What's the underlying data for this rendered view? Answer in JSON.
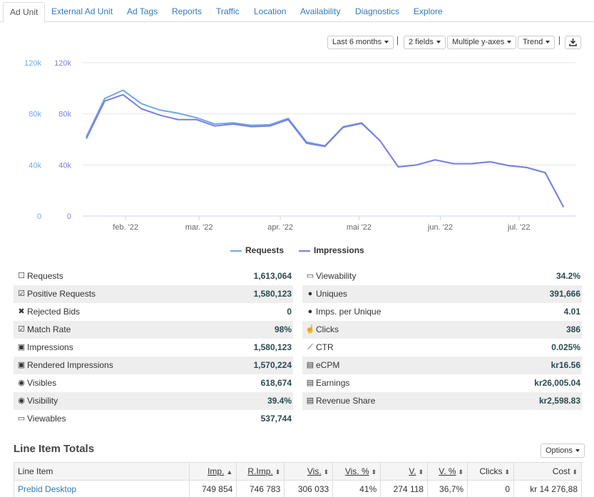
{
  "tabs": [
    "Ad Unit",
    "External Ad Unit",
    "Ad Tags",
    "Reports",
    "Traffic",
    "Location",
    "Availability",
    "Diagnostics",
    "Explore"
  ],
  "active_tab": "Ad Unit",
  "toolbar": {
    "range": "Last 6 months",
    "fields": "2 fields",
    "axes": "Multiple y-axes",
    "trend": "Trend",
    "download_icon": "download-icon"
  },
  "chart_data": {
    "type": "line",
    "x": [
      "2022-01-17",
      "2022-01-24",
      "2022-01-31",
      "2022-02-07",
      "2022-02-14",
      "2022-02-21",
      "2022-02-28",
      "2022-03-07",
      "2022-03-14",
      "2022-03-21",
      "2022-03-28",
      "2022-04-04",
      "2022-04-11",
      "2022-04-18",
      "2022-04-25",
      "2022-05-02",
      "2022-05-09",
      "2022-05-16",
      "2022-05-23",
      "2022-05-30",
      "2022-06-06",
      "2022-06-13",
      "2022-06-20",
      "2022-06-27",
      "2022-07-04",
      "2022-07-11",
      "2022-07-18"
    ],
    "x_tick_labels": [
      "feb. '22",
      "mar. '22",
      "apr. '22",
      "mai '22",
      "jun. '22",
      "jul. '22"
    ],
    "y_tick_labels": [
      "0",
      "40k",
      "80k",
      "120k"
    ],
    "ylim": [
      0,
      120000
    ],
    "grid": true,
    "legend_position": "bottom",
    "series": [
      {
        "name": "Requests",
        "color": "#6fa8e6",
        "values": [
          62000,
          92000,
          98500,
          88000,
          83000,
          80500,
          77000,
          72000,
          73000,
          71000,
          71500,
          76500,
          58000,
          55000,
          70000,
          73000,
          59000,
          38500,
          40000,
          44000,
          41000,
          41000,
          42500,
          39500,
          38000,
          34000,
          7000
        ]
      },
      {
        "name": "Impressions",
        "color": "#7b7fe0",
        "values": [
          60500,
          90000,
          95000,
          84000,
          79000,
          75500,
          75500,
          70500,
          72000,
          70000,
          70500,
          75500,
          57000,
          54500,
          69500,
          72500,
          59000,
          38500,
          40000,
          44000,
          41000,
          41000,
          42500,
          39500,
          38000,
          34000,
          7000
        ]
      }
    ]
  },
  "stats_left": [
    {
      "icon": "square-outline-icon",
      "label": "Requests",
      "value": "1,613,064"
    },
    {
      "icon": "checkbox-checked-icon",
      "label": "Positive Requests",
      "value": "1,580,123"
    },
    {
      "icon": "x-mark-icon",
      "label": "Rejected Bids",
      "value": "0"
    },
    {
      "icon": "checkbox-filled-icon",
      "label": "Match Rate",
      "value": "98%"
    },
    {
      "icon": "image-icon",
      "label": "Impressions",
      "value": "1,580,123"
    },
    {
      "icon": "image-icon",
      "label": "Rendered Impressions",
      "value": "1,570,224"
    },
    {
      "icon": "eye-icon",
      "label": "Visibles",
      "value": "618,674"
    },
    {
      "icon": "eye-icon",
      "label": "Visibility",
      "value": "39.4%"
    },
    {
      "icon": "monitor-icon",
      "label": "Viewables",
      "value": "537,744"
    }
  ],
  "stats_right": [
    {
      "icon": "monitor-icon",
      "label": "Viewability",
      "value": "34.2%"
    },
    {
      "icon": "user-icon",
      "label": "Uniques",
      "value": "391,666"
    },
    {
      "icon": "user-icon",
      "label": "Imps. per Unique",
      "value": "4.01"
    },
    {
      "icon": "pointer-hand-icon",
      "label": "Clicks",
      "value": "386"
    },
    {
      "icon": "line-chart-icon",
      "label": "CTR",
      "value": "0.025%"
    },
    {
      "icon": "money-icon",
      "label": "eCPM",
      "value": "kr16.56"
    },
    {
      "icon": "money-icon",
      "label": "Earnings",
      "value": "kr26,005.04"
    },
    {
      "icon": "money-icon",
      "label": "Revenue Share",
      "value": "kr2,598.83"
    }
  ],
  "line_items": {
    "title": "Line Item Totals",
    "options_label": "Options",
    "columns": [
      "Line Item",
      "Imp.",
      "R.Imp.",
      "Vis.",
      "Vis. %",
      "V.",
      "V. %",
      "Clicks",
      "Cost"
    ],
    "rows": [
      [
        "Prebid Desktop",
        "749 854",
        "746 783",
        "306 033",
        "41%",
        "274 118",
        "36,7%",
        "0",
        "kr 14 276,88"
      ]
    ]
  }
}
